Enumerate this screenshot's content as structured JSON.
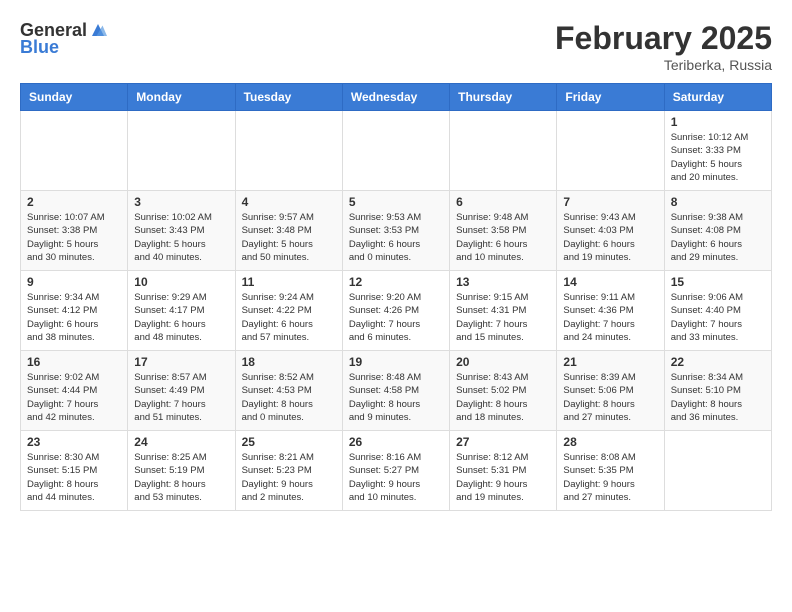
{
  "header": {
    "logo_line1": "General",
    "logo_line2": "Blue",
    "month_title": "February 2025",
    "location": "Teriberka, Russia"
  },
  "days_of_week": [
    "Sunday",
    "Monday",
    "Tuesday",
    "Wednesday",
    "Thursday",
    "Friday",
    "Saturday"
  ],
  "weeks": [
    [
      {
        "day": "",
        "info": ""
      },
      {
        "day": "",
        "info": ""
      },
      {
        "day": "",
        "info": ""
      },
      {
        "day": "",
        "info": ""
      },
      {
        "day": "",
        "info": ""
      },
      {
        "day": "",
        "info": ""
      },
      {
        "day": "1",
        "info": "Sunrise: 10:12 AM\nSunset: 3:33 PM\nDaylight: 5 hours\nand 20 minutes."
      }
    ],
    [
      {
        "day": "2",
        "info": "Sunrise: 10:07 AM\nSunset: 3:38 PM\nDaylight: 5 hours\nand 30 minutes."
      },
      {
        "day": "3",
        "info": "Sunrise: 10:02 AM\nSunset: 3:43 PM\nDaylight: 5 hours\nand 40 minutes."
      },
      {
        "day": "4",
        "info": "Sunrise: 9:57 AM\nSunset: 3:48 PM\nDaylight: 5 hours\nand 50 minutes."
      },
      {
        "day": "5",
        "info": "Sunrise: 9:53 AM\nSunset: 3:53 PM\nDaylight: 6 hours\nand 0 minutes."
      },
      {
        "day": "6",
        "info": "Sunrise: 9:48 AM\nSunset: 3:58 PM\nDaylight: 6 hours\nand 10 minutes."
      },
      {
        "day": "7",
        "info": "Sunrise: 9:43 AM\nSunset: 4:03 PM\nDaylight: 6 hours\nand 19 minutes."
      },
      {
        "day": "8",
        "info": "Sunrise: 9:38 AM\nSunset: 4:08 PM\nDaylight: 6 hours\nand 29 minutes."
      }
    ],
    [
      {
        "day": "9",
        "info": "Sunrise: 9:34 AM\nSunset: 4:12 PM\nDaylight: 6 hours\nand 38 minutes."
      },
      {
        "day": "10",
        "info": "Sunrise: 9:29 AM\nSunset: 4:17 PM\nDaylight: 6 hours\nand 48 minutes."
      },
      {
        "day": "11",
        "info": "Sunrise: 9:24 AM\nSunset: 4:22 PM\nDaylight: 6 hours\nand 57 minutes."
      },
      {
        "day": "12",
        "info": "Sunrise: 9:20 AM\nSunset: 4:26 PM\nDaylight: 7 hours\nand 6 minutes."
      },
      {
        "day": "13",
        "info": "Sunrise: 9:15 AM\nSunset: 4:31 PM\nDaylight: 7 hours\nand 15 minutes."
      },
      {
        "day": "14",
        "info": "Sunrise: 9:11 AM\nSunset: 4:36 PM\nDaylight: 7 hours\nand 24 minutes."
      },
      {
        "day": "15",
        "info": "Sunrise: 9:06 AM\nSunset: 4:40 PM\nDaylight: 7 hours\nand 33 minutes."
      }
    ],
    [
      {
        "day": "16",
        "info": "Sunrise: 9:02 AM\nSunset: 4:44 PM\nDaylight: 7 hours\nand 42 minutes."
      },
      {
        "day": "17",
        "info": "Sunrise: 8:57 AM\nSunset: 4:49 PM\nDaylight: 7 hours\nand 51 minutes."
      },
      {
        "day": "18",
        "info": "Sunrise: 8:52 AM\nSunset: 4:53 PM\nDaylight: 8 hours\nand 0 minutes."
      },
      {
        "day": "19",
        "info": "Sunrise: 8:48 AM\nSunset: 4:58 PM\nDaylight: 8 hours\nand 9 minutes."
      },
      {
        "day": "20",
        "info": "Sunrise: 8:43 AM\nSunset: 5:02 PM\nDaylight: 8 hours\nand 18 minutes."
      },
      {
        "day": "21",
        "info": "Sunrise: 8:39 AM\nSunset: 5:06 PM\nDaylight: 8 hours\nand 27 minutes."
      },
      {
        "day": "22",
        "info": "Sunrise: 8:34 AM\nSunset: 5:10 PM\nDaylight: 8 hours\nand 36 minutes."
      }
    ],
    [
      {
        "day": "23",
        "info": "Sunrise: 8:30 AM\nSunset: 5:15 PM\nDaylight: 8 hours\nand 44 minutes."
      },
      {
        "day": "24",
        "info": "Sunrise: 8:25 AM\nSunset: 5:19 PM\nDaylight: 8 hours\nand 53 minutes."
      },
      {
        "day": "25",
        "info": "Sunrise: 8:21 AM\nSunset: 5:23 PM\nDaylight: 9 hours\nand 2 minutes."
      },
      {
        "day": "26",
        "info": "Sunrise: 8:16 AM\nSunset: 5:27 PM\nDaylight: 9 hours\nand 10 minutes."
      },
      {
        "day": "27",
        "info": "Sunrise: 8:12 AM\nSunset: 5:31 PM\nDaylight: 9 hours\nand 19 minutes."
      },
      {
        "day": "28",
        "info": "Sunrise: 8:08 AM\nSunset: 5:35 PM\nDaylight: 9 hours\nand 27 minutes."
      },
      {
        "day": "",
        "info": ""
      }
    ]
  ]
}
